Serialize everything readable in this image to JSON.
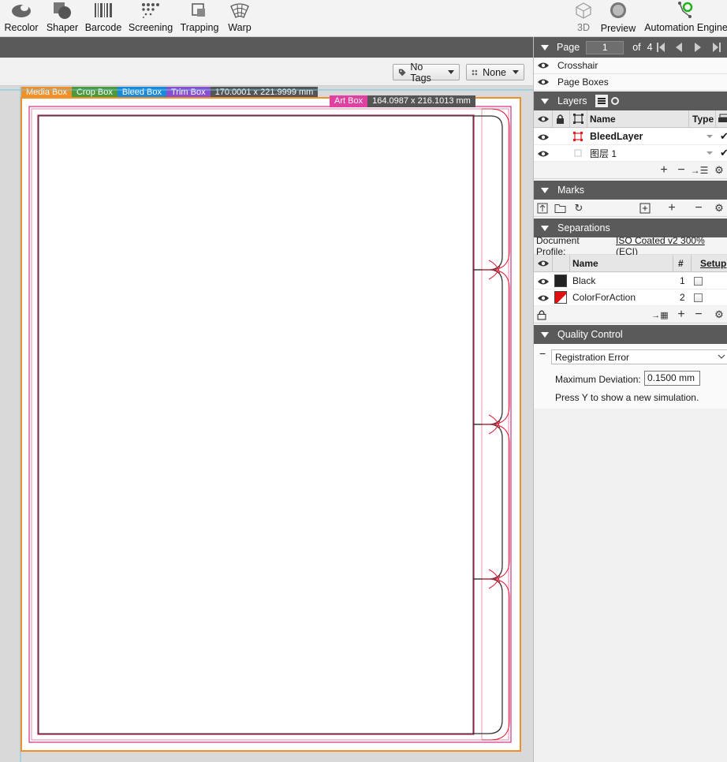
{
  "toolbar": {
    "tools": [
      {
        "name": "recolor",
        "label": "Recolor"
      },
      {
        "name": "shaper",
        "label": "Shaper"
      },
      {
        "name": "barcode",
        "label": "Barcode"
      },
      {
        "name": "screening",
        "label": "Screening"
      },
      {
        "name": "trapping",
        "label": "Trapping"
      },
      {
        "name": "warp",
        "label": "Warp"
      }
    ],
    "right_tools": [
      {
        "name": "3d",
        "label": "3D"
      },
      {
        "name": "preview",
        "label": "Preview"
      },
      {
        "name": "automation-engine",
        "label": "Automation Engine"
      }
    ]
  },
  "tagbar": {
    "tags_label": "No Tags",
    "filter_label": "None"
  },
  "boxes": {
    "media": "Media Box",
    "crop": "Crop Box",
    "bleed": "Bleed Box",
    "trim": "Trim Box",
    "trim_size": "170.0001 x 221.9999 mm",
    "art": "Art Box",
    "art_size": "164.0987 x 216.1013 mm",
    "colors": {
      "media": "#f0902a",
      "crop": "#4e9a3a",
      "bleed": "#1a8ad8",
      "trim": "#8a4ed0",
      "art": "#e040a0"
    }
  },
  "pagenav": {
    "label": "Page",
    "current": "1",
    "of_label": "of",
    "total": "4"
  },
  "view_options": [
    {
      "label": "Crosshair"
    },
    {
      "label": "Page Boxes"
    }
  ],
  "layers": {
    "title": "Layers",
    "col_name": "Name",
    "col_type": "Type",
    "rows": [
      {
        "name": "BleedLayer"
      },
      {
        "name": "图层 1"
      }
    ]
  },
  "marks": {
    "title": "Marks"
  },
  "separations": {
    "title": "Separations",
    "profile_label": "Document Profile:",
    "profile_value": "ISO Coated v2 300% (ECI)",
    "col_name": "Name",
    "col_num": "#",
    "col_setup": "Setup",
    "rows": [
      {
        "name": "Black",
        "num": "1",
        "color": "#222222"
      },
      {
        "name": "ColorForAction",
        "num": "2",
        "color": "#e01010"
      }
    ]
  },
  "quality": {
    "title": "Quality Control",
    "check": "Registration Error",
    "max_dev_label": "Maximum Deviation:",
    "max_dev_value": "0.1500 mm",
    "hint": "Press Y to show a new simulation."
  }
}
